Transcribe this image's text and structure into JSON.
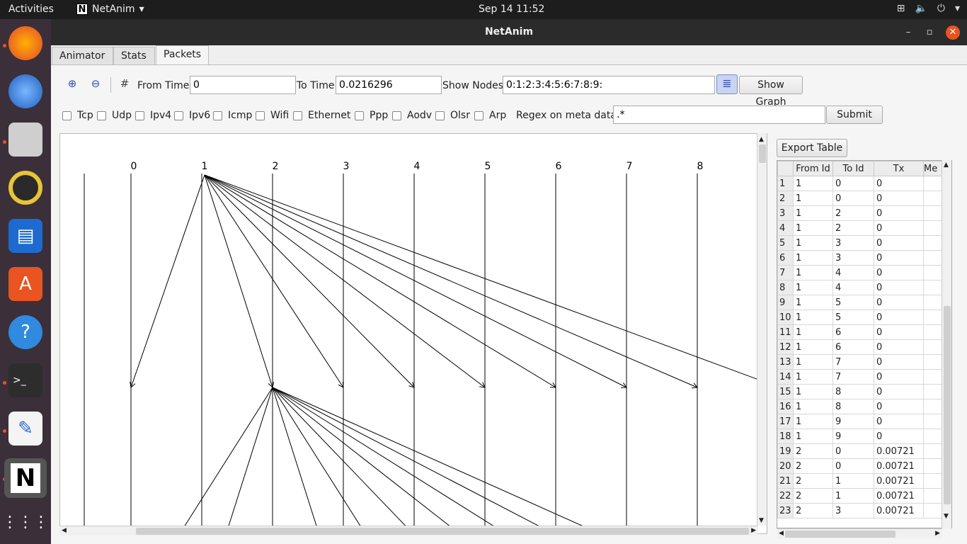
{
  "topbar": {
    "activities": "Activities",
    "app_name": "NetAnim",
    "clock": "Sep 14  11:52"
  },
  "window": {
    "title": "NetAnim"
  },
  "tabs": [
    {
      "label": "Animator"
    },
    {
      "label": "Stats"
    },
    {
      "label": "Packets"
    }
  ],
  "toolbar": {
    "from_time_label": "From Time",
    "from_time_value": "0",
    "to_time_label": "To Time",
    "to_time_value": "0.0216296",
    "show_nodes_label": "Show Nodes",
    "show_nodes_value": "0:1:2:3:4:5:6:7:8:9:",
    "show_graph_label": "Show Graph"
  },
  "filters": {
    "protocols": [
      "Tcp",
      "Udp",
      "Ipv4",
      "Ipv6",
      "Icmp",
      "Wifi",
      "Ethernet",
      "Ppp",
      "Aodv",
      "Olsr",
      "Arp"
    ],
    "regex_label": "Regex on meta data",
    "regex_value": ".*",
    "submit_label": "Submit"
  },
  "graph": {
    "node_labels": [
      "0",
      "1",
      "2",
      "3",
      "4",
      "5",
      "6",
      "7",
      "8"
    ]
  },
  "table": {
    "export_label": "Export Table",
    "columns": [
      "From Id",
      "To Id",
      "Tx",
      "Me"
    ],
    "rows": [
      [
        "1",
        "1",
        "0",
        "0"
      ],
      [
        "2",
        "1",
        "0",
        "0"
      ],
      [
        "3",
        "1",
        "2",
        "0"
      ],
      [
        "4",
        "1",
        "2",
        "0"
      ],
      [
        "5",
        "1",
        "3",
        "0"
      ],
      [
        "6",
        "1",
        "3",
        "0"
      ],
      [
        "7",
        "1",
        "4",
        "0"
      ],
      [
        "8",
        "1",
        "4",
        "0"
      ],
      [
        "9",
        "1",
        "5",
        "0"
      ],
      [
        "10",
        "1",
        "5",
        "0"
      ],
      [
        "11",
        "1",
        "6",
        "0"
      ],
      [
        "12",
        "1",
        "6",
        "0"
      ],
      [
        "13",
        "1",
        "7",
        "0"
      ],
      [
        "14",
        "1",
        "7",
        "0"
      ],
      [
        "15",
        "1",
        "8",
        "0"
      ],
      [
        "16",
        "1",
        "8",
        "0"
      ],
      [
        "17",
        "1",
        "9",
        "0"
      ],
      [
        "18",
        "1",
        "9",
        "0"
      ],
      [
        "19",
        "2",
        "0",
        "0.00721"
      ],
      [
        "20",
        "2",
        "0",
        "0.00721"
      ],
      [
        "21",
        "2",
        "1",
        "0.00721"
      ],
      [
        "22",
        "2",
        "1",
        "0.00721"
      ],
      [
        "23",
        "2",
        "3",
        "0.00721"
      ]
    ]
  }
}
